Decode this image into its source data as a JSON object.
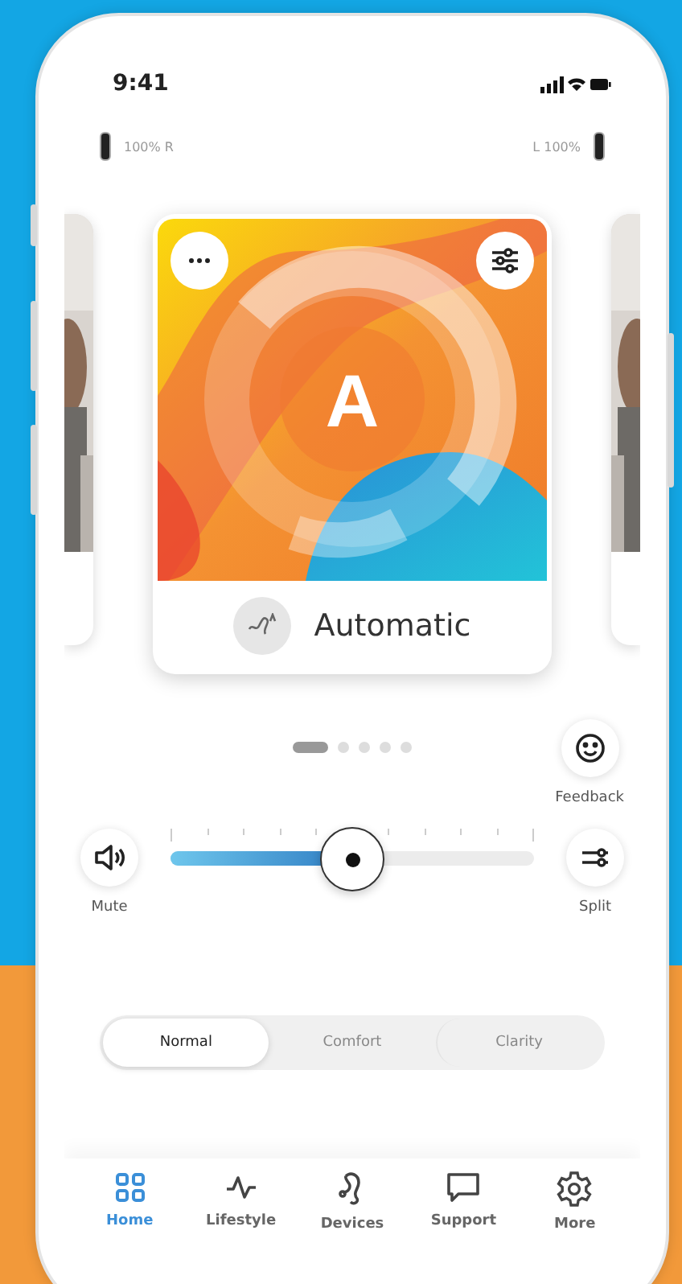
{
  "status_bar": {
    "time": "9:41"
  },
  "hearing_aids": [
    {
      "label": "100% R"
    },
    {
      "label": "L 100%"
    }
  ],
  "program_card": {
    "letter": "A",
    "title": "Automatic"
  },
  "page_dots": [
    {
      "selected": true
    },
    {
      "selected": false
    },
    {
      "selected": false
    },
    {
      "selected": false
    },
    {
      "selected": false
    }
  ],
  "feedback": {
    "label": "Feedback"
  },
  "mute": {
    "label": "Mute"
  },
  "split": {
    "label": "Split"
  },
  "volume": {
    "level": 0.5
  },
  "modes": [
    {
      "label": "Normal",
      "selected": true
    },
    {
      "label": "Comfort",
      "selected": false
    },
    {
      "label": "Clarity",
      "selected": false
    }
  ],
  "nav": [
    {
      "kind": "home",
      "label": "Home",
      "selected": true
    },
    {
      "kind": "lifestyle",
      "label": "Lifestyle",
      "selected": false
    },
    {
      "kind": "devices",
      "label": "Devices",
      "selected": false
    },
    {
      "kind": "support",
      "label": "Support",
      "selected": false
    },
    {
      "kind": "more",
      "label": "More",
      "selected": false
    }
  ]
}
